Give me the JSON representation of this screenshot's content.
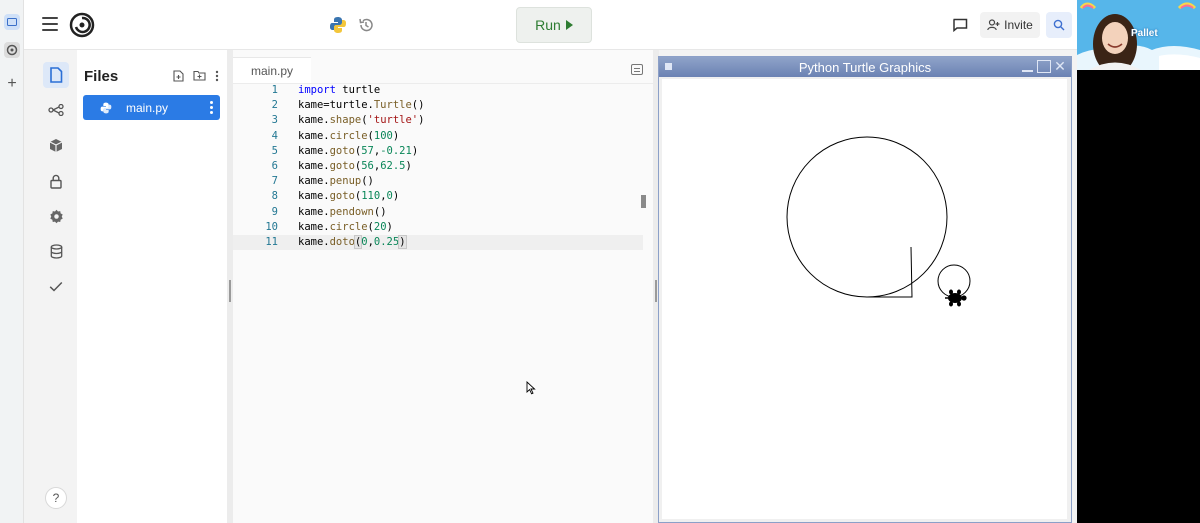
{
  "header": {
    "run_label": "Run",
    "invite_label": "Invite"
  },
  "files_panel": {
    "title": "Files",
    "items": [
      {
        "label": "main.py"
      }
    ]
  },
  "editor": {
    "tab_label": "main.py",
    "lines": [
      {
        "n": "1",
        "code": "import turtle"
      },
      {
        "n": "2",
        "code": "kame=turtle.Turtle()"
      },
      {
        "n": "3",
        "code": "kame.shape('turtle')"
      },
      {
        "n": "4",
        "code": "kame.circle(100)"
      },
      {
        "n": "5",
        "code": "kame.goto(57,-0.21)"
      },
      {
        "n": "6",
        "code": "kame.goto(56,62.5)"
      },
      {
        "n": "7",
        "code": "kame.penup()"
      },
      {
        "n": "8",
        "code": "kame.goto(110,0)"
      },
      {
        "n": "9",
        "code": "kame.pendown()"
      },
      {
        "n": "10",
        "code": "kame.circle(20)"
      },
      {
        "n": "11",
        "code": "kame.doto(0,0.25)"
      }
    ]
  },
  "turtle_window": {
    "title": "Python Turtle Graphics"
  },
  "webcam": {
    "brand": "Pallet"
  },
  "sidebar": {
    "help_label": "?"
  },
  "colors": {
    "accent": "#2b7be5",
    "run_green": "#2e7d32",
    "window_title": "#7a8fbd"
  },
  "icons": [
    "menu-icon",
    "logo-icon",
    "python-icon",
    "history-icon",
    "play-icon",
    "chat-icon",
    "add-user-icon",
    "search-icon",
    "file-icon",
    "share-icon",
    "package-icon",
    "lock-icon",
    "gear-icon",
    "database-icon",
    "check-icon",
    "help-icon",
    "new-file-icon",
    "new-folder-icon",
    "more-icon"
  ]
}
